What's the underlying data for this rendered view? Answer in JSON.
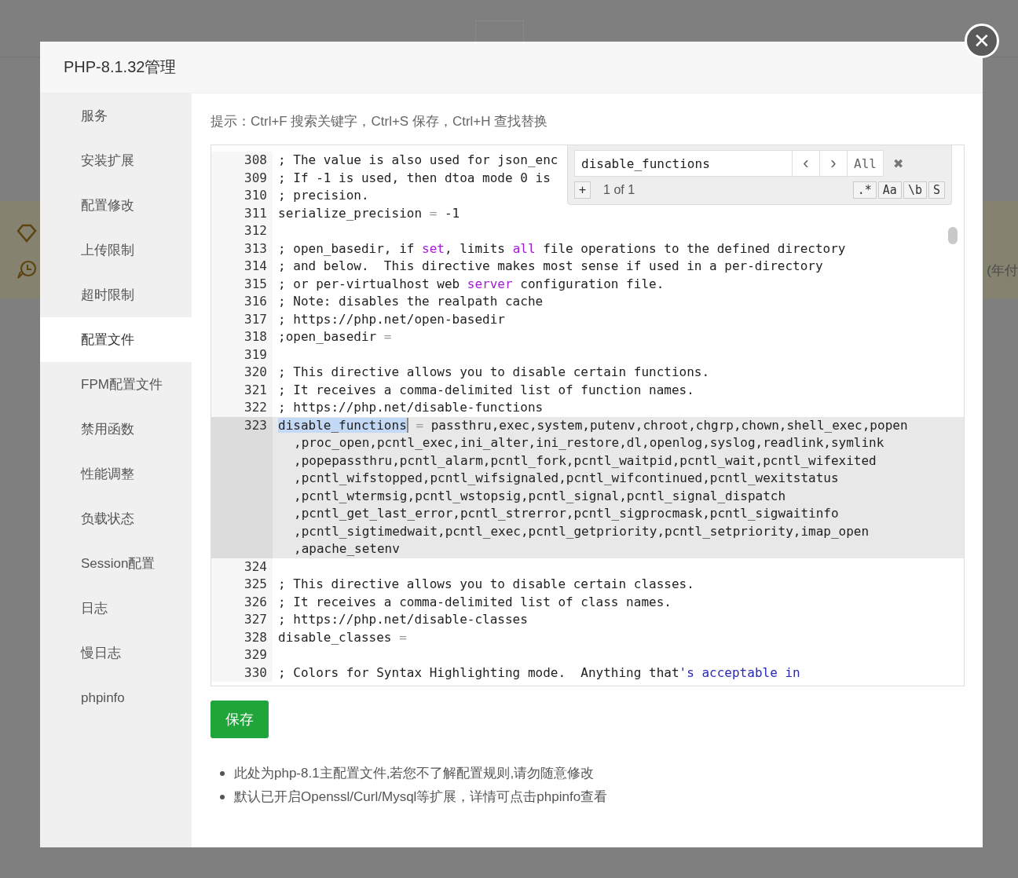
{
  "background": {
    "text": "(年付"
  },
  "dialog": {
    "title": "PHP-8.1.32管理",
    "close": "✕"
  },
  "sidebar": {
    "items": [
      {
        "label": "服务",
        "selected": false
      },
      {
        "label": "安装扩展",
        "selected": false
      },
      {
        "label": "配置修改",
        "selected": false
      },
      {
        "label": "上传限制",
        "selected": false
      },
      {
        "label": "超时限制",
        "selected": false
      },
      {
        "label": "配置文件",
        "selected": true
      },
      {
        "label": "FPM配置文件",
        "selected": false
      },
      {
        "label": "禁用函数",
        "selected": false
      },
      {
        "label": "性能调整",
        "selected": false
      },
      {
        "label": "负载状态",
        "selected": false
      },
      {
        "label": "Session配置",
        "selected": false
      },
      {
        "label": "日志",
        "selected": false
      },
      {
        "label": "慢日志",
        "selected": false
      },
      {
        "label": "phpinfo",
        "selected": false
      }
    ]
  },
  "hint": "提示：Ctrl+F 搜索关键字，Ctrl+S 保存，Ctrl+H 查找替换",
  "editor": {
    "lines": [
      {
        "number": "308",
        "active": false,
        "segments": [
          {
            "kind": "plain",
            "text": "; The value is also used for json_enc"
          }
        ]
      },
      {
        "number": "309",
        "active": false,
        "segments": [
          {
            "kind": "plain",
            "text": "; If -1 is used, then dtoa mode 0 is"
          }
        ]
      },
      {
        "number": "310",
        "active": false,
        "segments": [
          {
            "kind": "plain",
            "text": "; precision."
          }
        ]
      },
      {
        "number": "311",
        "active": false,
        "segments": [
          {
            "kind": "plain",
            "text": "serialize_precision "
          },
          {
            "kind": "operator",
            "text": "="
          },
          {
            "kind": "plain",
            "text": " -1"
          }
        ]
      },
      {
        "number": "312",
        "active": false
      },
      {
        "number": "313",
        "active": false,
        "segments": [
          {
            "kind": "plain",
            "text": "; open_basedir, if "
          },
          {
            "kind": "keyword",
            "text": "set"
          },
          {
            "kind": "plain",
            "text": ", limits "
          },
          {
            "kind": "keyword",
            "text": "all"
          },
          {
            "kind": "plain",
            "text": " file operations to the defined directory"
          }
        ]
      },
      {
        "number": "314",
        "active": false,
        "segments": [
          {
            "kind": "plain",
            "text": "; and below.  This directive makes most sense if used in a per-directory"
          }
        ]
      },
      {
        "number": "315",
        "active": false,
        "segments": [
          {
            "kind": "plain",
            "text": "; or per-virtualhost web "
          },
          {
            "kind": "keyword",
            "text": "server"
          },
          {
            "kind": "plain",
            "text": " configuration file."
          }
        ]
      },
      {
        "number": "316",
        "active": false,
        "segments": [
          {
            "kind": "plain",
            "text": "; Note: disables the realpath cache"
          }
        ]
      },
      {
        "number": "317",
        "active": false,
        "segments": [
          {
            "kind": "plain",
            "text": "; https://php.net/open-basedir"
          }
        ]
      },
      {
        "number": "318",
        "active": false,
        "segments": [
          {
            "kind": "plain",
            "text": ";open_basedir "
          },
          {
            "kind": "operator",
            "text": "="
          }
        ]
      },
      {
        "number": "319",
        "active": false
      },
      {
        "number": "320",
        "active": false,
        "segments": [
          {
            "kind": "plain",
            "text": "; This directive allows you to disable certain functions."
          }
        ]
      },
      {
        "number": "321",
        "active": false,
        "segments": [
          {
            "kind": "plain",
            "text": "; It receives a comma-delimited list of function names."
          }
        ]
      },
      {
        "number": "322",
        "active": false,
        "segments": [
          {
            "kind": "plain",
            "text": "; https://php.net/disable-functions"
          }
        ]
      },
      {
        "number": "323",
        "active": true,
        "segments": [
          {
            "kind": "match",
            "text": "disable_functions"
          },
          {
            "kind": "operator",
            "text": " ="
          },
          {
            "kind": "plain",
            "text": " passthru,exec,system,putenv,chroot,chgrp,chown,shell_exec,popen"
          }
        ],
        "continuation": [
          ",proc_open,pcntl_exec,ini_alter,ini_restore,dl,openlog,syslog,readlink,symlink",
          ",popepassthru,pcntl_alarm,pcntl_fork,pcntl_waitpid,pcntl_wait,pcntl_wifexited",
          ",pcntl_wifstopped,pcntl_wifsignaled,pcntl_wifcontinued,pcntl_wexitstatus",
          ",pcntl_wtermsig,pcntl_wstopsig,pcntl_signal,pcntl_signal_dispatch",
          ",pcntl_get_last_error,pcntl_strerror,pcntl_sigprocmask,pcntl_sigwaitinfo",
          ",pcntl_sigtimedwait,pcntl_exec,pcntl_getpriority,pcntl_setpriority,imap_open",
          ",apache_setenv"
        ]
      },
      {
        "number": "324",
        "active": false
      },
      {
        "number": "325",
        "active": false,
        "segments": [
          {
            "kind": "plain",
            "text": "; This directive allows you to disable certain classes."
          }
        ]
      },
      {
        "number": "326",
        "active": false,
        "segments": [
          {
            "kind": "plain",
            "text": "; It receives a comma-delimited list of class names."
          }
        ]
      },
      {
        "number": "327",
        "active": false,
        "segments": [
          {
            "kind": "plain",
            "text": "; https://php.net/disable-classes"
          }
        ]
      },
      {
        "number": "328",
        "active": false,
        "segments": [
          {
            "kind": "plain",
            "text": "disable_classes "
          },
          {
            "kind": "operator",
            "text": "="
          }
        ]
      },
      {
        "number": "329",
        "active": false
      },
      {
        "number": "330",
        "active": false,
        "segments": [
          {
            "kind": "plain",
            "text": "; Colors for Syntax Highlighting mode.  Anything that"
          },
          {
            "kind": "string",
            "text": "'s acceptable in"
          }
        ]
      }
    ],
    "search": {
      "value": "disable_functions",
      "prev": "‹",
      "next": "›",
      "all": "All",
      "close": "✖",
      "add": "+",
      "count": "1 of 1",
      "options": [
        ".*",
        "Aa",
        "\\b",
        "S"
      ]
    }
  },
  "save_button": "保存",
  "notes": [
    "此处为php-8.1主配置文件,若您不了解配置规则,请勿随意修改",
    "默认已开启Openssl/Curl/Mysql等扩展，详情可点击phpinfo查看"
  ]
}
